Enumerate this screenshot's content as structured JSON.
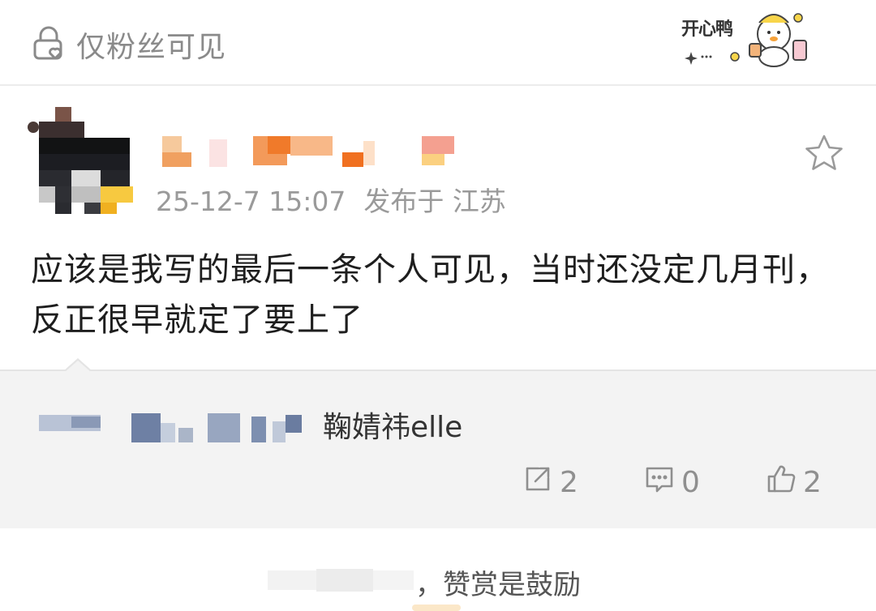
{
  "visibility": {
    "label": "仅粉丝可见",
    "icon": "lock-heart-icon"
  },
  "sticker": {
    "text": "开心鸭",
    "icon": "happy-duck-sticker"
  },
  "post": {
    "timestamp": "25-12-7 15:07",
    "location": "发布于 江苏",
    "text": "应该是我写的最后一条个人可见，当时还没定几月刊，反正很早就定了要上了"
  },
  "quote": {
    "name_suffix": "鞠婧祎elle"
  },
  "actions": {
    "repost_count": "2",
    "comment_count": "0",
    "like_count": "2"
  },
  "reward": {
    "text": "，赞赏是鼓励"
  },
  "colors": {
    "meta": "#9a9a9a",
    "quote_bg": "#f3f3f3",
    "blur_orange": "#f28a2e"
  }
}
